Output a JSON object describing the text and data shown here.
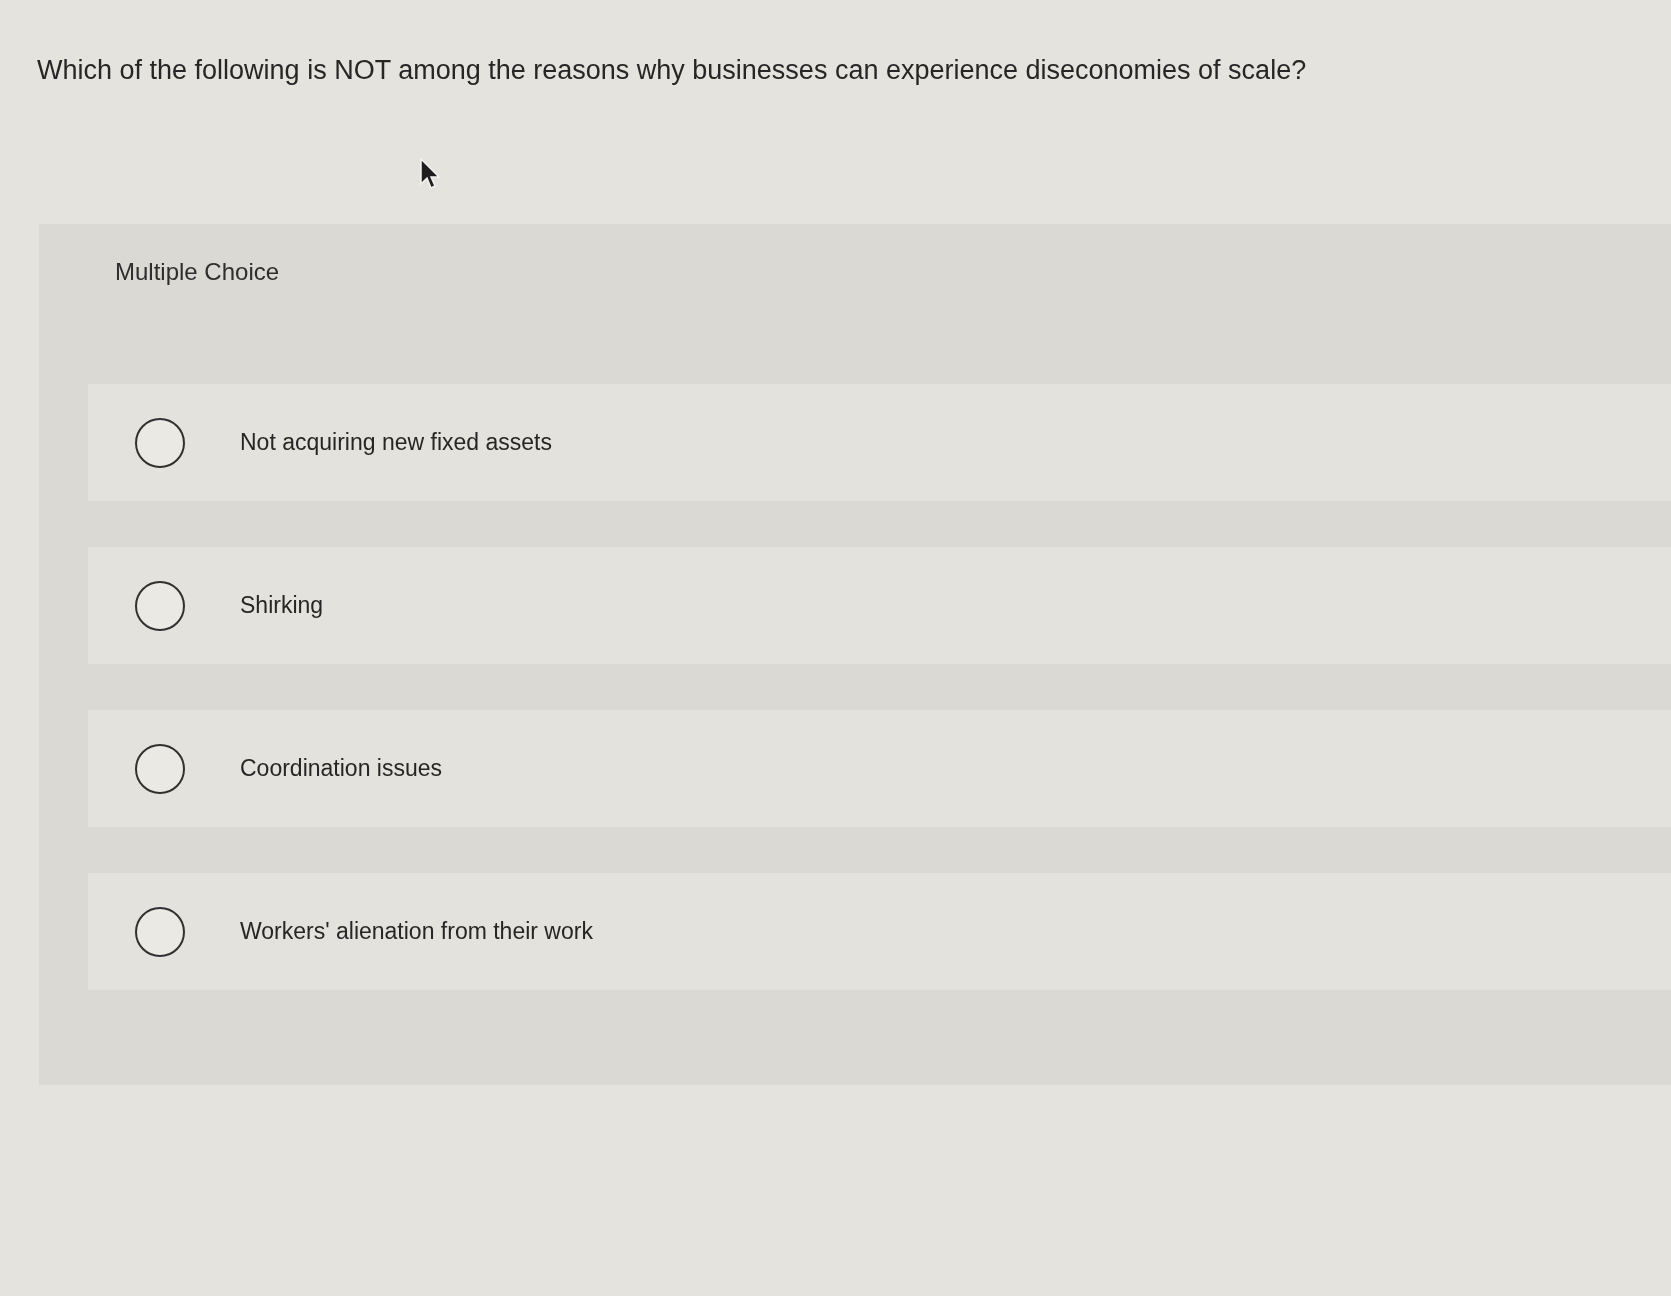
{
  "question": "Which of the following is NOT among the reasons why businesses can experience diseconomies of scale?",
  "answer_panel": {
    "label": "Multiple Choice",
    "options": [
      {
        "text": "Not acquiring new fixed assets",
        "selected": false
      },
      {
        "text": "Shirking",
        "selected": false
      },
      {
        "text": "Coordination issues",
        "selected": false
      },
      {
        "text": "Workers' alienation from their work",
        "selected": false
      }
    ]
  }
}
